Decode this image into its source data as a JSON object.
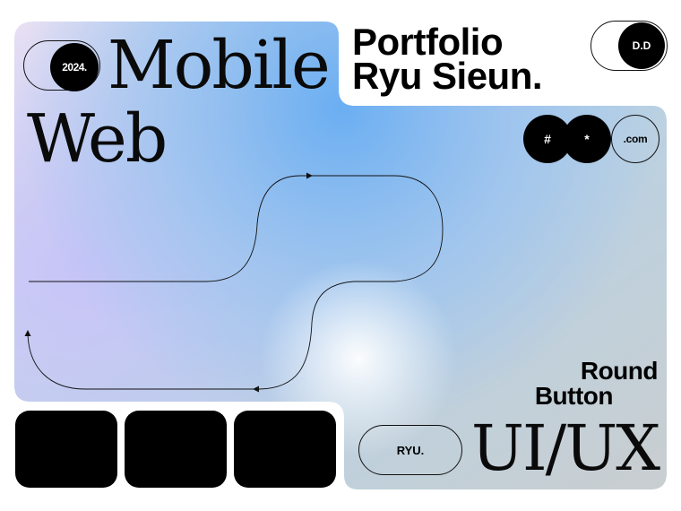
{
  "card": {
    "colors": {
      "lavender": "#ece3f4",
      "periwinkle": "#c3c6f8",
      "sky": "#72b2f0",
      "mist": "#b3cdd9",
      "gray": "#c8cdcf",
      "glow": "#ffffff"
    }
  },
  "hero": {
    "year": "2024.",
    "title_line1": "Mobile",
    "title_line2": "Web"
  },
  "portfolio": {
    "line1": "Portfolio",
    "line2": "Ryu Sieun.",
    "badge": "D.D"
  },
  "tags": {
    "hash": "#",
    "star": "*",
    "dotcom": ".com"
  },
  "round_button": {
    "line1": "Round",
    "line2": "Button"
  },
  "bottom": {
    "ryu": "RYU.",
    "uiux": "UI/UX"
  }
}
